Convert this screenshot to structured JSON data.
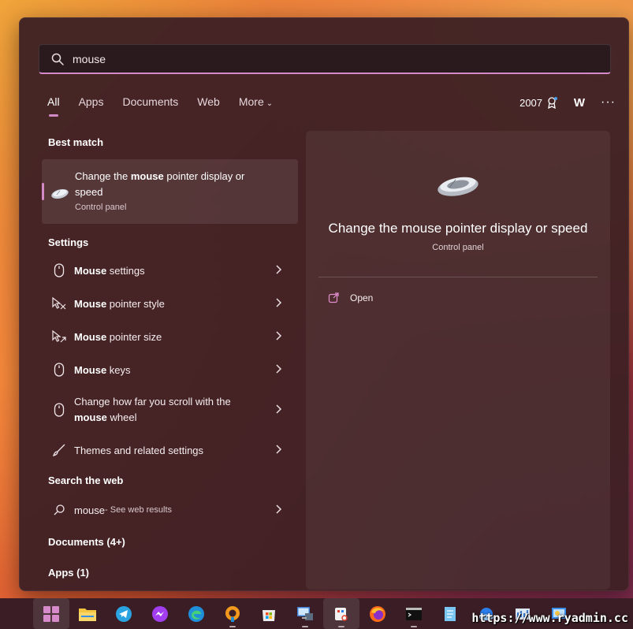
{
  "search": {
    "value": "mouse",
    "icon": "search-icon"
  },
  "tabs": [
    {
      "label": "All",
      "active": true
    },
    {
      "label": "Apps",
      "active": false
    },
    {
      "label": "Documents",
      "active": false
    },
    {
      "label": "Web",
      "active": false
    },
    {
      "label": "More",
      "active": false
    }
  ],
  "header_tools": {
    "points": "2007",
    "avatar_initial": "W",
    "more_icon": "ellipsis-icon"
  },
  "best_match": {
    "heading": "Best match",
    "title_pre": "Change the ",
    "title_bold": "mouse",
    "title_post": " pointer display or speed",
    "subtitle": "Control panel",
    "icon": "mouse-icon"
  },
  "settings": {
    "heading": "Settings",
    "items": [
      {
        "bold": "Mouse",
        "rest": " settings",
        "icon": "mouse-outline-icon"
      },
      {
        "bold": "Mouse",
        "rest": " pointer style",
        "icon": "pointer-style-icon"
      },
      {
        "bold": "Mouse",
        "rest": " pointer size",
        "icon": "pointer-size-icon"
      },
      {
        "bold": "Mouse",
        "rest": " keys",
        "icon": "mouse-outline-icon"
      },
      {
        "pre": "Change how far you scroll with the ",
        "bold": "mouse",
        "rest": " wheel",
        "icon": "mouse-outline-icon"
      },
      {
        "plain": "Themes and related settings",
        "icon": "brush-icon"
      }
    ]
  },
  "web": {
    "heading": "Search the web",
    "query": "mouse",
    "suffix": " - See web results"
  },
  "documents": {
    "heading": "Documents (4+)"
  },
  "apps": {
    "heading": "Apps (1)"
  },
  "preview": {
    "title": "Change the mouse pointer display or speed",
    "subtitle": "Control panel",
    "open_label": "Open"
  },
  "taskbar": {
    "icons": [
      "start-icon",
      "file-explorer-icon",
      "telegram-icon",
      "messenger-icon",
      "edge-icon",
      "app-orange-icon",
      "store-icon",
      "remote-desktop-icon",
      "snipping-tool-icon",
      "firefox-icon",
      "terminal-icon",
      "notepad-icon",
      "cloud-icon",
      "network-icon",
      "control-panel-icon"
    ]
  },
  "watermark": "https://www.ryadmin.cc",
  "colors": {
    "accent": "#d58ac8",
    "panel": "#3e2024",
    "taskbar": "#3a1d25"
  }
}
